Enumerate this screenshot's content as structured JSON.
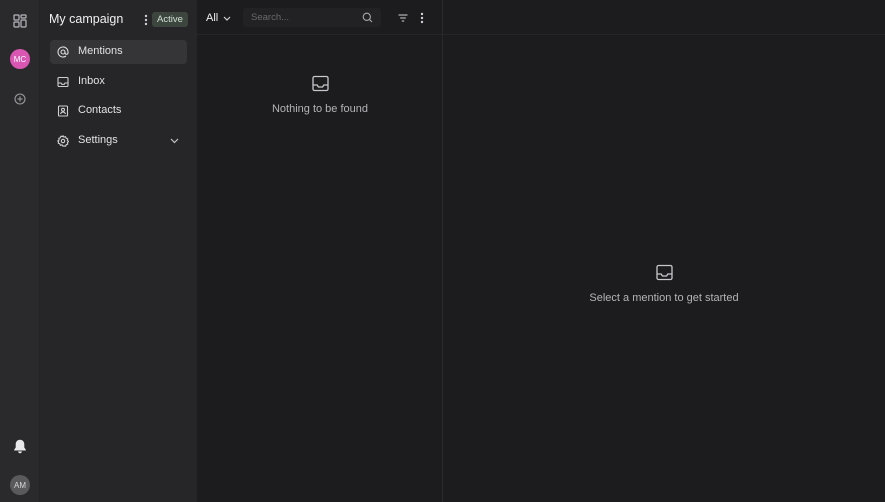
{
  "rail": {
    "workspace_avatar": "MC",
    "user_avatar": "AM",
    "colors": {
      "workspace_avatar_bg": "#d957b2",
      "user_avatar_bg": "#5a595c"
    }
  },
  "sidebar": {
    "campaign_title": "My campaign",
    "status_badge": "Active",
    "items": [
      {
        "label": "Mentions",
        "icon": "at-sign-icon",
        "active": true
      },
      {
        "label": "Inbox",
        "icon": "inbox-icon",
        "active": false
      },
      {
        "label": "Contacts",
        "icon": "contacts-icon",
        "active": false
      },
      {
        "label": "Settings",
        "icon": "gear-icon",
        "active": false,
        "has_submenu": true
      }
    ]
  },
  "list": {
    "filter_value": "All",
    "search_placeholder": "Search...",
    "empty_message": "Nothing to be found"
  },
  "detail": {
    "empty_message": "Select a mention to get started"
  }
}
